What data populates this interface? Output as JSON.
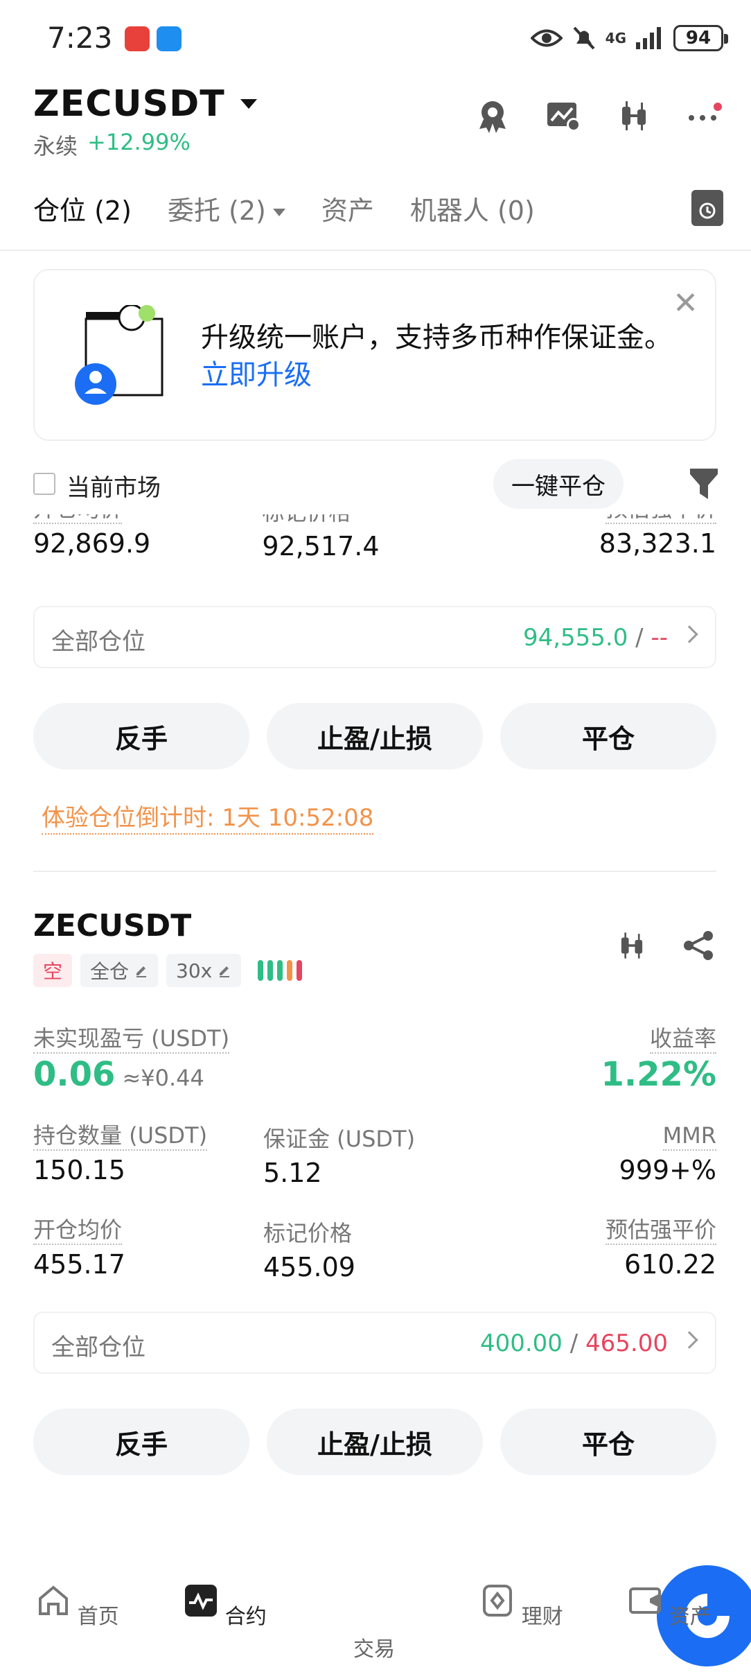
{
  "status": {
    "time": "7:23",
    "battery": "94",
    "network": "4G"
  },
  "header": {
    "symbol": "ZECUSDT",
    "type": "永续",
    "change": "+12.99%"
  },
  "tabs": [
    {
      "label": "仓位 (2)"
    },
    {
      "label": "委托 (2)"
    },
    {
      "label": "资产"
    },
    {
      "label": "机器人 (0)"
    }
  ],
  "banner": {
    "text": "升级统一账户，支持多币种作保证金。",
    "link": "立即升级"
  },
  "filter": {
    "current_market": "当前市场",
    "close_all": "一键平仓"
  },
  "position1": {
    "labels": {
      "open_avg": "开仓均价",
      "mark_price": "标记价格",
      "liq_price": "预估强平价"
    },
    "open_avg": "92,869.9",
    "mark_price": "92,517.4",
    "liq_price": "83,323.1",
    "all_positions_label": "全部仓位",
    "tp": "94,555.0",
    "sep": "/",
    "sl": "--",
    "buttons": {
      "reverse": "反手",
      "tpsl": "止盈/止损",
      "close": "平仓"
    },
    "countdown": "体验仓位倒计时:  1天 10:52:08"
  },
  "position2": {
    "symbol": "ZECUSDT",
    "side": "空",
    "margin_mode": "全仓",
    "leverage": "30x",
    "pnl_label": "未实现盈亏 (USDT)",
    "pnl": "0.06",
    "pnl_cny": "≈¥0.44",
    "roe_label": "收益率",
    "roe": "1.22%",
    "size_label": "持仓数量 (USDT)",
    "size": "150.15",
    "margin_label": "保证金 (USDT)",
    "margin": "5.12",
    "mmr_label": "MMR",
    "mmr": "999+%",
    "open_avg_label": "开仓均价",
    "open_avg": "455.17",
    "mark_label": "标记价格",
    "mark": "455.09",
    "liq_label": "预估强平价",
    "liq": "610.22",
    "all_positions_label": "全部仓位",
    "tp": "400.00",
    "sep": "/",
    "sl": "465.00",
    "buttons": {
      "reverse": "反手",
      "tpsl": "止盈/止损",
      "close": "平仓"
    }
  },
  "nav": [
    {
      "label": "首页",
      "icon": "home-icon"
    },
    {
      "label": "合约",
      "icon": "futures-icon"
    },
    {
      "label": "交易",
      "icon": "trade-icon"
    },
    {
      "label": "理财",
      "icon": "earn-icon"
    },
    {
      "label": "资产",
      "icon": "wallet-icon"
    }
  ],
  "colors": {
    "green": "#2fbd85",
    "red": "#e6455f",
    "orange": "#f2934a",
    "blue": "#1b6ef3"
  },
  "risk_bars": [
    "#2fbd85",
    "#2fbd85",
    "#2fbd85",
    "#f2934a",
    "#e6455f"
  ]
}
